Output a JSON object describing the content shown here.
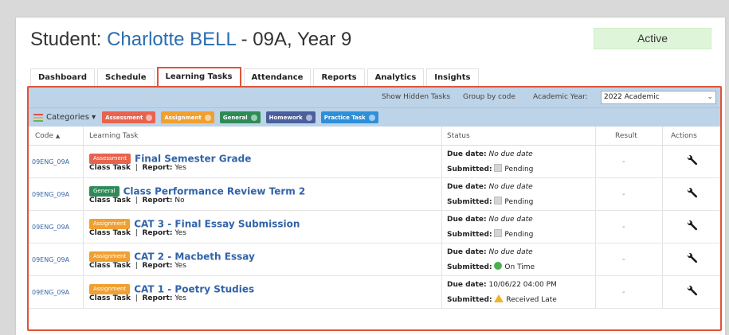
{
  "header": {
    "title_prefix": "Student: ",
    "student_name": "Charlotte BELL",
    "title_suffix": " - 09A, Year 9",
    "status": "Active"
  },
  "tabs": [
    {
      "label": "Dashboard",
      "active": false
    },
    {
      "label": "Schedule",
      "active": false
    },
    {
      "label": "Learning Tasks",
      "active": true
    },
    {
      "label": "Attendance",
      "active": false
    },
    {
      "label": "Reports",
      "active": false
    },
    {
      "label": "Analytics",
      "active": false
    },
    {
      "label": "Insights",
      "active": false
    }
  ],
  "toolbar": {
    "show_hidden": "Show Hidden Tasks",
    "group_by": "Group by code",
    "academic_year_label": "Academic Year:",
    "academic_year_value": "2022 Academic"
  },
  "categories": {
    "label": "Categories",
    "chips": [
      {
        "label": "Assessment",
        "color": "#e8634e"
      },
      {
        "label": "Assignment",
        "color": "#f0a030"
      },
      {
        "label": "General",
        "color": "#2e8b57"
      },
      {
        "label": "Homework",
        "color": "#4a5f9c"
      },
      {
        "label": "Practice Task",
        "color": "#2f8fd8"
      }
    ]
  },
  "table": {
    "headers": {
      "code": "Code",
      "task": "Learning Task",
      "status": "Status",
      "result": "Result",
      "actions": "Actions"
    },
    "rows": [
      {
        "code": "09ENG_09A",
        "badge": "Assessment",
        "badge_color": "#e8634e",
        "title": "Final Semester Grade",
        "type_label": "Class Task",
        "report_label": "Report:",
        "report_value": "Yes",
        "due_label": "Due date:",
        "due_value": "No due date",
        "submitted_label": "Submitted:",
        "submitted_value": "Pending",
        "submitted_icon": "pending",
        "result": "-"
      },
      {
        "code": "09ENG_09A",
        "badge": "General",
        "badge_color": "#2e8b57",
        "title": "Class Performance Review Term 2",
        "type_label": "Class Task",
        "report_label": "Report:",
        "report_value": "No",
        "due_label": "Due date:",
        "due_value": "No due date",
        "submitted_label": "Submitted:",
        "submitted_value": "Pending",
        "submitted_icon": "pending",
        "result": "-"
      },
      {
        "code": "09ENG_09A",
        "badge": "Assignment",
        "badge_color": "#f0a030",
        "title": "CAT 3 - Final Essay Submission",
        "type_label": "Class Task",
        "report_label": "Report:",
        "report_value": "Yes",
        "due_label": "Due date:",
        "due_value": "No due date",
        "submitted_label": "Submitted:",
        "submitted_value": "Pending",
        "submitted_icon": "pending",
        "result": "-"
      },
      {
        "code": "09ENG_09A",
        "badge": "Assignment",
        "badge_color": "#f0a030",
        "title": "CAT 2 - Macbeth Essay",
        "type_label": "Class Task",
        "report_label": "Report:",
        "report_value": "Yes",
        "due_label": "Due date:",
        "due_value": "No due date",
        "submitted_label": "Submitted:",
        "submitted_value": "On Time",
        "submitted_icon": "ontime",
        "result": "-"
      },
      {
        "code": "09ENG_09A",
        "badge": "Assignment",
        "badge_color": "#f0a030",
        "title": "CAT 1 - Poetry Studies",
        "type_label": "Class Task",
        "report_label": "Report:",
        "report_value": "Yes",
        "due_label": "Due date:",
        "due_value": "10/06/22 04:00 PM",
        "submitted_label": "Submitted:",
        "submitted_value": "Received Late",
        "submitted_icon": "late",
        "result": "-"
      }
    ]
  },
  "icons": {
    "action": "wrench-icon",
    "categories": "list-icon",
    "sort": "sort-asc-icon"
  }
}
